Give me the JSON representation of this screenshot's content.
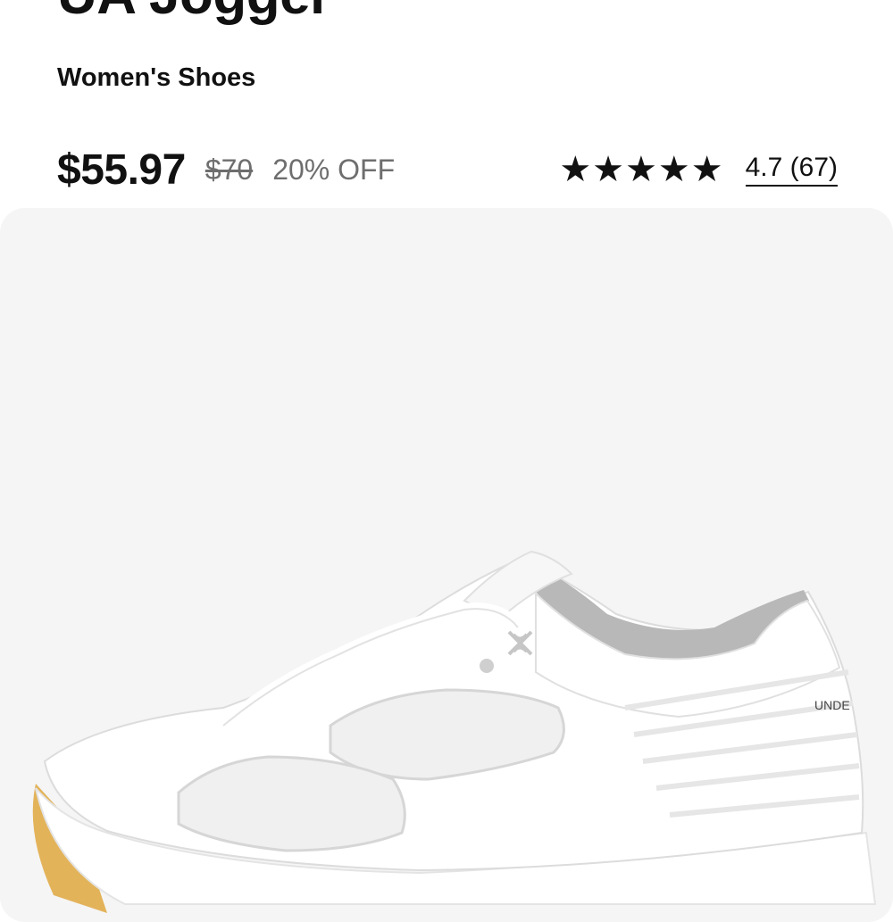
{
  "product": {
    "title": "UA Jogger",
    "subtitle": "Women's Shoes"
  },
  "pricing": {
    "current": "$55.97",
    "original": "$70",
    "discount": "20% OFF"
  },
  "rating": {
    "stars_filled": 5,
    "stars_total": 5,
    "label": "4.7 (67)"
  },
  "image": {
    "alt": "White Under Armour jogger sneaker with gum sole",
    "brand_text": "UNDE",
    "colors": {
      "panel": "#f5f5f5",
      "shoe": "#ffffff",
      "collar": "#b8b8b8",
      "sole_gum": "#e3b35a"
    }
  }
}
